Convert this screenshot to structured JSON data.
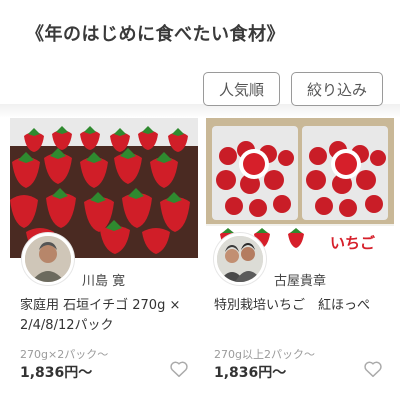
{
  "header": {
    "title": "《年のはじめに食べたい食材》"
  },
  "filters": {
    "sort_label": "人気順",
    "filter_label": "絞り込み"
  },
  "products": [
    {
      "producer": "川島 寛",
      "title": "家庭用 石垣イチゴ 270g × 2/4/8/12パック",
      "quantity": "270g×2パック～",
      "price": "1,836円～"
    },
    {
      "producer": "古屋貴章",
      "title": "特別栽培いちご　紅ほっぺ",
      "quantity": "270g以上2パック～",
      "price": "1,836円～",
      "package_label": "いちご"
    }
  ],
  "colors": {
    "strawberry": "#d8202a",
    "leaf": "#2f8a2f",
    "border": "#9a9a9a"
  }
}
